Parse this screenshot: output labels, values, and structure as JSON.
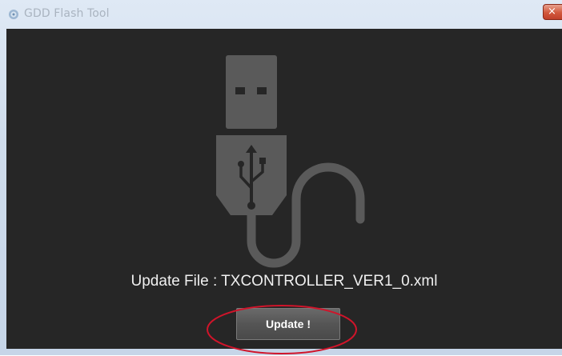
{
  "window": {
    "title": "GDD Flash Tool",
    "close_label": "×"
  },
  "main": {
    "update_file_label": "Update File : ",
    "update_file_name": "TXCONTROLLER_VER1_0.xml",
    "update_button_label": "Update !"
  },
  "icons": {
    "app": "app-icon",
    "usb": "usb-cable-icon",
    "close": "close-icon"
  },
  "colors": {
    "content_background": "#262626",
    "usb_icon": "#5a5a5a",
    "annotation_ellipse": "#d0142a"
  }
}
